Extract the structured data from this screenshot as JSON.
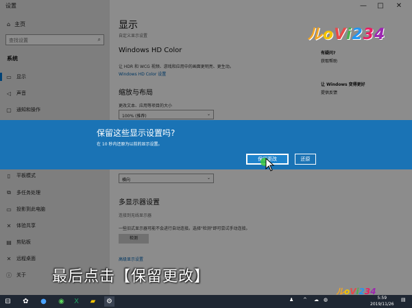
{
  "window": {
    "title": "设置",
    "controls": [
      "—",
      "□",
      "✕"
    ]
  },
  "sidebar": {
    "home": "主页",
    "search_placeholder": "查找设置",
    "section": "系统",
    "items": [
      {
        "label": "显示",
        "icon": "monitor-icon",
        "glyph": "▭"
      },
      {
        "label": "声音",
        "icon": "speaker-icon",
        "glyph": "◁"
      },
      {
        "label": "通知和操作",
        "icon": "notification-icon",
        "glyph": "▢"
      },
      {
        "label": "平板模式",
        "icon": "tablet-icon",
        "glyph": "▯"
      },
      {
        "label": "多任务处理",
        "icon": "multitask-icon",
        "glyph": "⧉"
      },
      {
        "label": "投影到此电脑",
        "icon": "project-icon",
        "glyph": "▭"
      },
      {
        "label": "体验共享",
        "icon": "share-icon",
        "glyph": "✕"
      },
      {
        "label": "剪贴板",
        "icon": "clipboard-icon",
        "glyph": "▤"
      },
      {
        "label": "远程桌面",
        "icon": "remote-icon",
        "glyph": "✕"
      },
      {
        "label": "关于",
        "icon": "info-icon",
        "glyph": "ⓘ"
      }
    ]
  },
  "main": {
    "title": "显示",
    "title_sub": "自定义显示设置",
    "hd_color_heading": "Windows HD Color",
    "hd_color_desc": "让 HDR 和 WCG 视频、游戏和应用中的画面更明亮、更生动。",
    "hd_color_link": "Windows HD Color 设置",
    "scale_heading": "缩放与布局",
    "scale_label": "更改文本、应用等项目的大小",
    "scale_value": "100% (推荐)",
    "orientation_value": "横向",
    "multi_heading": "多显示器设置",
    "multi_link": "连接到无线显示器",
    "multi_desc": "一些旧式显示器可能不会进行自动连接。选择\"检测\"即可尝试手动连接。",
    "detect_button": "检测",
    "advanced_link": "高级显示设置"
  },
  "right": {
    "question_heading": "有疑问?",
    "question_link": "获取帮助",
    "improve_heading": "让 Windows 变得更好",
    "improve_link": "提供反馈"
  },
  "dialog": {
    "title": "保留这些显示设置吗?",
    "message": "在 10 秒内还原为以前的显示设置。",
    "keep_button": "保留更改",
    "revert_button": "还原"
  },
  "caption": "最后点击【保留更改】",
  "watermark": "ルoVi234",
  "taskbar": {
    "time": "5:59",
    "date": "2019/11/26"
  }
}
